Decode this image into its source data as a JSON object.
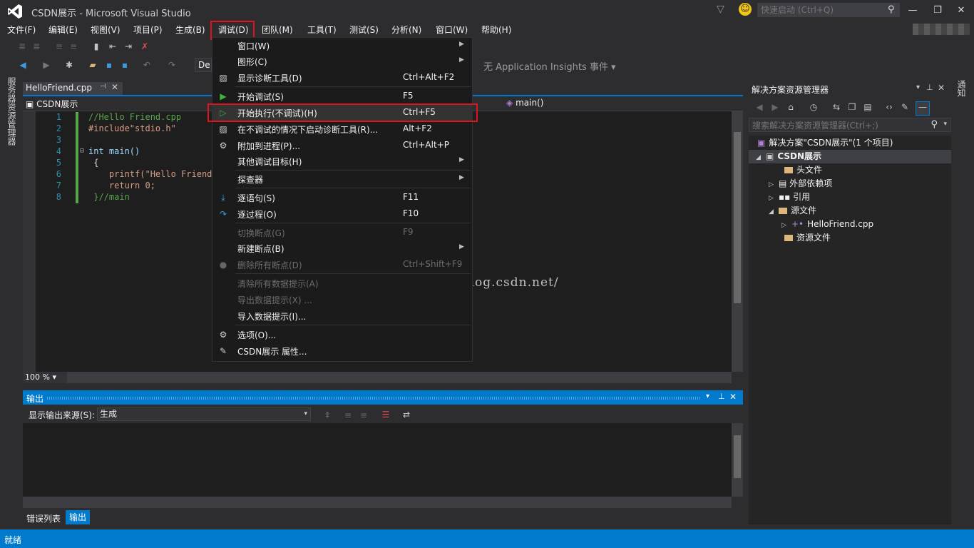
{
  "window": {
    "title": "CSDN展示 - Microsoft Visual Studio",
    "quick_launch_placeholder": "快速启动 (Ctrl+Q)",
    "minimize": "—",
    "maximize": "❐",
    "close": "✕"
  },
  "menubar": {
    "items": [
      "文件(F)",
      "编辑(E)",
      "视图(V)",
      "项目(P)",
      "生成(B)",
      "调试(D)",
      "团队(M)",
      "工具(T)",
      "测试(S)",
      "分析(N)",
      "窗口(W)",
      "帮助(H)"
    ]
  },
  "toolbar": {
    "config": "De",
    "app_insights": "无 Application Insights 事件 ▾"
  },
  "left_strip": {
    "label": "服务器资源管理器"
  },
  "editor": {
    "tab_label": "HelloFriend.cpp",
    "nav_scope": "CSDN展示",
    "nav_member": "main()",
    "zoom": "100 %",
    "lines": [
      {
        "num": "1",
        "text": "//Hello Friend.cpp"
      },
      {
        "num": "2",
        "text": "#include\"stdio.h\""
      },
      {
        "num": "3",
        "text": ""
      },
      {
        "num": "4",
        "text": "int main()"
      },
      {
        "num": "5",
        "text": " {"
      },
      {
        "num": "6",
        "text": "    printf(\"Hello Friend!"
      },
      {
        "num": "7",
        "text": "    return 0;"
      },
      {
        "num": "8",
        "text": " }//main"
      }
    ]
  },
  "watermark": "http://blog.csdn.net/",
  "output": {
    "title": "输出",
    "source_label": "显示输出来源(S):",
    "source_value": "生成"
  },
  "bottom_tabs": {
    "errors": "错误列表",
    "output": "输出"
  },
  "solution_explorer": {
    "title": "解决方案资源管理器",
    "search_placeholder": "搜索解决方案资源管理器(Ctrl+;)",
    "solution": "解决方案\"CSDN展示\"(1 个项目)",
    "project": "CSDN展示",
    "headers": "头文件",
    "external_deps": "外部依赖项",
    "references": "引用",
    "source_files": "源文件",
    "source_file_item": "HelloFriend.cpp",
    "resource_files": "资源文件"
  },
  "right_strip": {
    "label": "通知"
  },
  "status": {
    "text": "就绪"
  },
  "debug_menu": {
    "items": [
      {
        "label": "窗口(W)",
        "key": "",
        "submenu": true
      },
      {
        "label": "图形(C)",
        "key": "",
        "submenu": true
      },
      {
        "label": "显示诊断工具(D)",
        "key": "Ctrl+Alt+F2"
      },
      {
        "label": "开始调试(S)",
        "key": "F5"
      },
      {
        "label": "开始执行(不调试)(H)",
        "key": "Ctrl+F5"
      },
      {
        "label": "在不调试的情况下启动诊断工具(R)...",
        "key": "Alt+F2"
      },
      {
        "label": "附加到进程(P)...",
        "key": "Ctrl+Alt+P"
      },
      {
        "label": "其他调试目标(H)",
        "key": "",
        "submenu": true
      },
      {
        "label": "探查器",
        "key": "",
        "submenu": true
      },
      {
        "label": "逐语句(S)",
        "key": "F11"
      },
      {
        "label": "逐过程(O)",
        "key": "F10"
      },
      {
        "label": "切换断点(G)",
        "key": "F9",
        "disabled": true
      },
      {
        "label": "新建断点(B)",
        "key": "",
        "submenu": true
      },
      {
        "label": "删除所有断点(D)",
        "key": "Ctrl+Shift+F9",
        "disabled": true
      },
      {
        "label": "清除所有数据提示(A)",
        "key": "",
        "disabled": true
      },
      {
        "label": "导出数据提示(X) ...",
        "key": "",
        "disabled": true
      },
      {
        "label": "导入数据提示(I)...",
        "key": ""
      },
      {
        "label": "选项(O)...",
        "key": ""
      },
      {
        "label": "CSDN展示 属性...",
        "key": ""
      }
    ]
  },
  "colors": {
    "accent": "#007acc",
    "highlight_frame": "#e0141e",
    "background": "#2d2d30"
  }
}
